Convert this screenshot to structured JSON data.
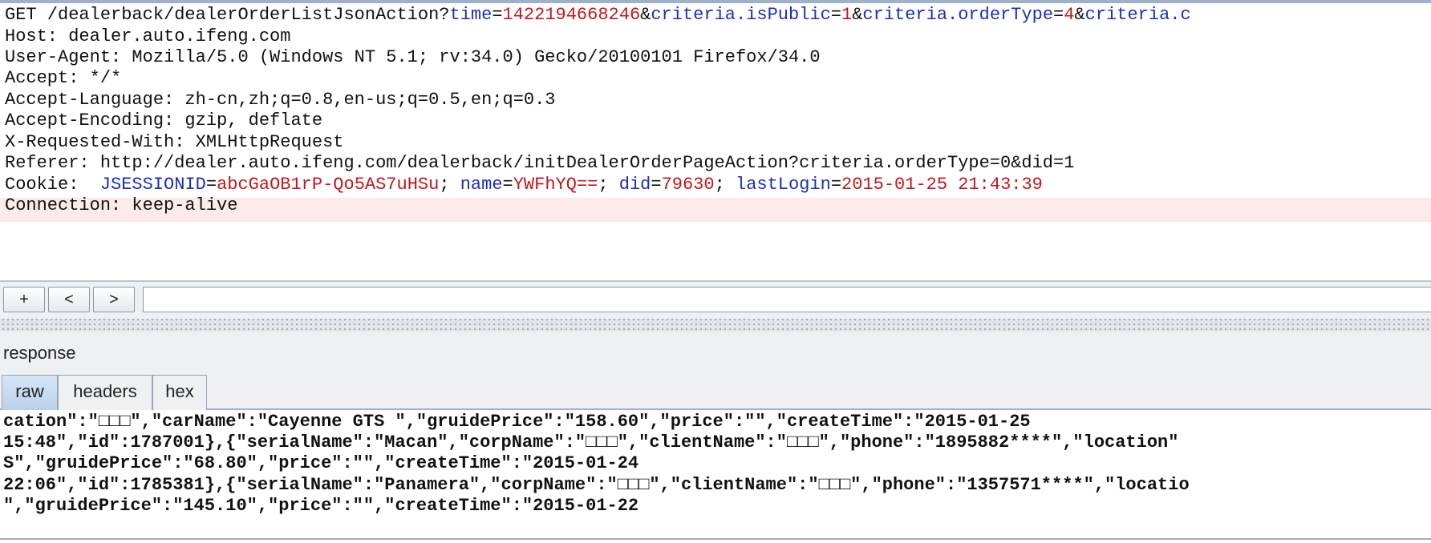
{
  "request": {
    "line1": {
      "prefix": "GET /dealerback/dealerOrderListJsonAction?",
      "p1_key": "time",
      "p1_val": "1422194668246",
      "p2_key": "criteria.isPublic",
      "p2_val": "1",
      "p3_key": "criteria.orderType",
      "p3_val": "4",
      "p4_key": "criteria.c"
    },
    "host": "Host: dealer.auto.ifeng.com",
    "user_agent": "User-Agent: Mozilla/5.0 (Windows NT 5.1; rv:34.0) Gecko/20100101 Firefox/34.0",
    "accept": "Accept: */*",
    "accept_language": "Accept-Language: zh-cn,zh;q=0.8,en-us;q=0.5,en;q=0.3",
    "accept_encoding": "Accept-Encoding: gzip, deflate",
    "x_requested_with": "X-Requested-With: XMLHttpRequest",
    "referer": "Referer: http://dealer.auto.ifeng.com/dealerback/initDealerOrderPageAction?criteria.orderType=0&did=1",
    "cookie": {
      "label": "Cookie:  ",
      "c1_key": "JSESSIONID",
      "c1_val": "abcGaOB1rP-Qo5AS7uHSu",
      "c2_key": "name",
      "c2_val": "YWFhYQ==",
      "c3_key": "did",
      "c3_val": "79630",
      "c4_key": "lastLogin",
      "c4_val": "2015-01-25 21:43:39"
    },
    "connection": "Connection: keep-alive"
  },
  "toolbar": {
    "add_label": "+",
    "prev_label": "<",
    "next_label": ">",
    "search_value": ""
  },
  "response": {
    "title": "response",
    "tabs": [
      "raw",
      "headers",
      "hex"
    ],
    "lines": [
      "cation\":\"□□□\",\"carName\":\"Cayenne GTS \",\"gruidePrice\":\"158.60\",\"price\":\"\",\"createTime\":\"2015-01-25",
      "15:48\",\"id\":1787001},{\"serialName\":\"Macan\",\"corpName\":\"□□□\",\"clientName\":\"□□□\",\"phone\":\"1895882****\",\"location\"",
      "S\",\"gruidePrice\":\"68.80\",\"price\":\"\",\"createTime\":\"2015-01-24",
      "22:06\",\"id\":1785381},{\"serialName\":\"Panamera\",\"corpName\":\"□□□\",\"clientName\":\"□□□\",\"phone\":\"1357571****\",\"locatio",
      "\",\"gruidePrice\":\"145.10\",\"price\":\"\",\"createTime\":\"2015-01-22"
    ]
  }
}
